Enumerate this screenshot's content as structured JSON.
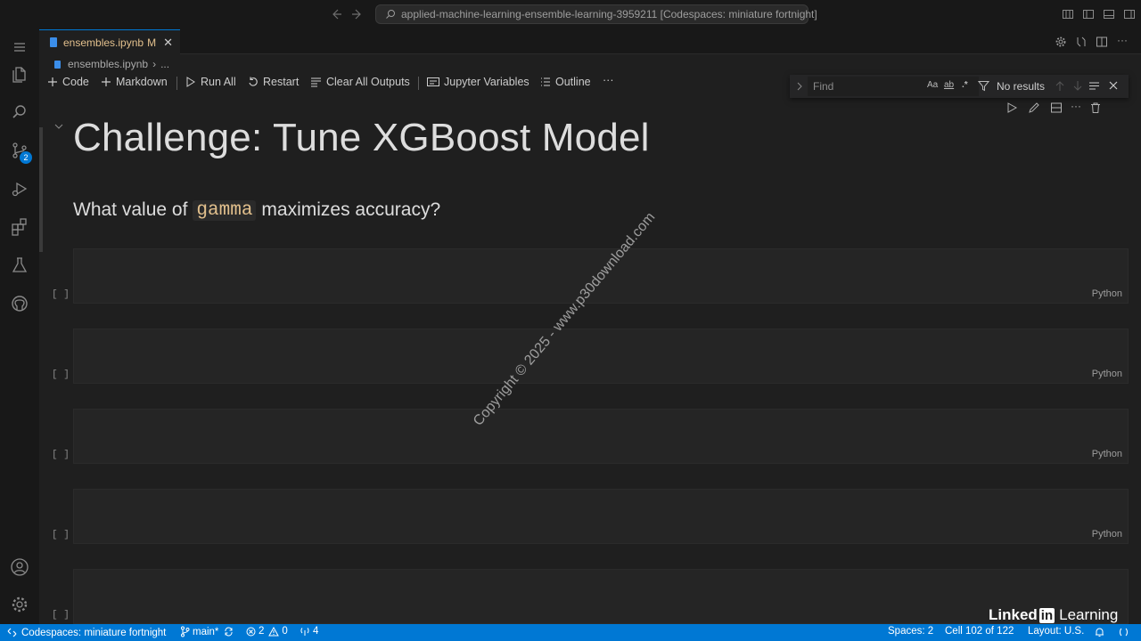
{
  "titlebar": {
    "command_center": "applied-machine-learning-ensemble-learning-3959211 [Codespaces: miniature fortnight]"
  },
  "activitybar": {
    "items": [
      "explorer-icon",
      "search-icon",
      "source-control-icon",
      "run-debug-icon",
      "extensions-icon",
      "testing-icon",
      "github-icon"
    ],
    "source_control_badge": "2",
    "bottom": [
      "account-icon",
      "settings-gear-icon"
    ]
  },
  "tabs": [
    {
      "label": "ensembles.ipynb",
      "modified": "M"
    }
  ],
  "breadcrumb": {
    "file": "ensembles.ipynb",
    "separator": "›",
    "more": "..."
  },
  "notebook_toolbar": {
    "code": "Code",
    "markdown": "Markdown",
    "run_all": "Run All",
    "restart": "Restart",
    "clear_outputs": "Clear All Outputs",
    "variables": "Jupyter Variables",
    "outline": "Outline",
    "more": "···"
  },
  "find": {
    "placeholder": "Find",
    "match_case": "Aa",
    "whole_word": "ab",
    "regex": ".*",
    "results": "No results"
  },
  "content": {
    "heading": "Challenge: Tune XGBoost Model",
    "question_before": "What value of",
    "question_code": "gamma",
    "question_after": "maximizes accuracy?"
  },
  "cells": [
    {
      "exec": "[ ]",
      "language": "Python"
    },
    {
      "exec": "[ ]",
      "language": "Python"
    },
    {
      "exec": "[ ]",
      "language": "Python"
    },
    {
      "exec": "[ ]",
      "language": "Python"
    },
    {
      "exec": "[ ]",
      "language": ""
    }
  ],
  "watermark": "Copyright © 2025 - www.p30download.com",
  "brand": {
    "linked": "Linked",
    "in": "in",
    "learning": "Learning"
  },
  "statusbar": {
    "remote": "Codespaces: miniature fortnight",
    "branch": "main*",
    "errors": "2",
    "warnings": "0",
    "ports": "4",
    "spaces": "Spaces: 2",
    "cell": "Cell 102 of 122",
    "layout": "Layout: U.S."
  },
  "colors": {
    "accent": "#0078d4",
    "modified": "#e2c08d",
    "background": "#1f1f1f"
  }
}
